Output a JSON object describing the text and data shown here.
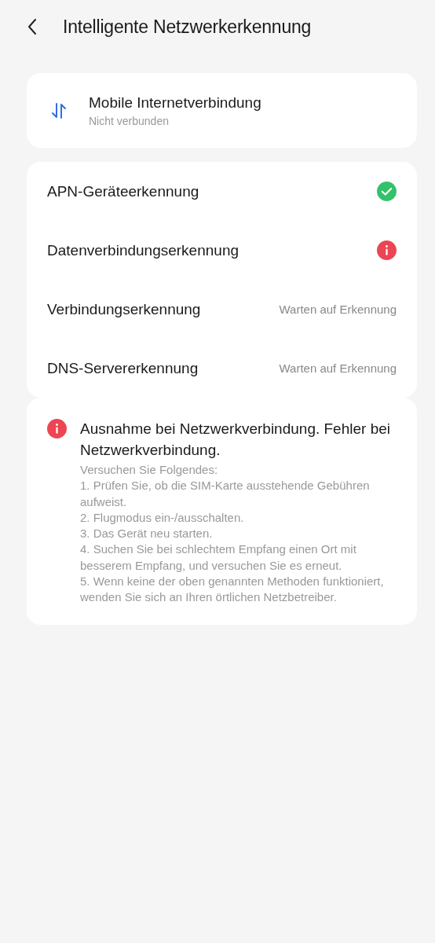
{
  "header": {
    "title": "Intelligente Netzwerkerkennung"
  },
  "connection": {
    "title": "Mobile Internetverbindung",
    "status": "Nicht verbunden"
  },
  "checks": [
    {
      "label": "APN-Geräteerkennung",
      "kind": "ok"
    },
    {
      "label": "Datenverbindungserkennung",
      "kind": "error"
    },
    {
      "label": "Verbindungserkennung",
      "kind": "pending",
      "status": "Warten auf Erkennung"
    },
    {
      "label": "DNS-Servererkennung",
      "kind": "pending",
      "status": "Warten auf Erkennung"
    }
  ],
  "notice": {
    "title": "Ausnahme bei Netzwerkverbindung. Fehler bei Netzwerkverbindung.",
    "lines": [
      "Versuchen Sie Folgendes:",
      "1. Prüfen Sie, ob die SIM-Karte ausstehende Gebühren aufweist.",
      "2. Flugmodus ein-/ausschalten.",
      "3. Das Gerät neu starten.",
      "4. Suchen Sie bei schlechtem Empfang einen Ort mit besserem Empfang, und versuchen Sie es erneut.",
      "5. Wenn keine der oben genannten Methoden funktioniert, wenden Sie sich an Ihren örtlichen Netzbetreiber."
    ]
  }
}
